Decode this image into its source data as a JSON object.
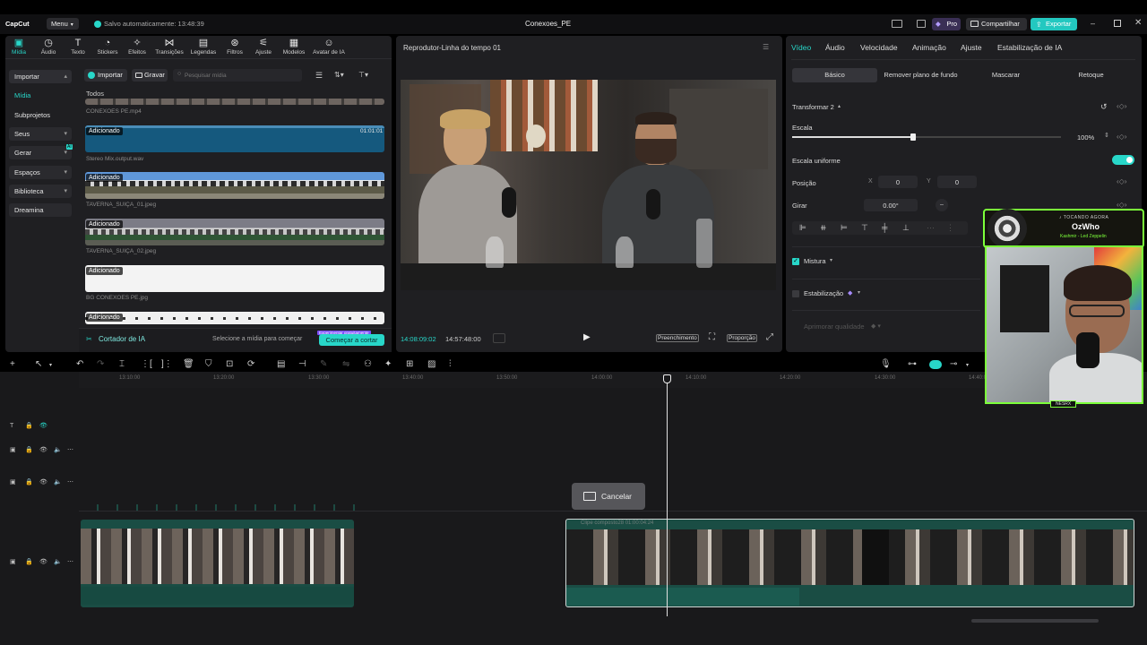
{
  "app": {
    "logo": "CapCut",
    "menu_label": "Menu",
    "autosave": "Salvo automaticamente: 13:48:39",
    "project_title": "Conexoes_PE",
    "pro_label": "Pro",
    "share_label": "Compartilhar",
    "export_label": "Exportar"
  },
  "top_tabs": [
    "Mídia",
    "Áudio",
    "Texto",
    "Stickers",
    "Efeitos",
    "Transições",
    "Legendas",
    "Filtros",
    "Ajuste",
    "Modelos",
    "Avatar de IA"
  ],
  "sidebar": {
    "items": [
      "Importar",
      "Mídia",
      "Subprojetos",
      "Seus",
      "Gerar",
      "Espaços",
      "Biblioteca",
      "Dreamina"
    ],
    "gerar_badge": "AI"
  },
  "media": {
    "import_label": "Importar",
    "record_label": "Gravar",
    "search_placeholder": "Pesquisar mídia",
    "all_label": "Todos",
    "added_tag": "Adicionado",
    "items": [
      "CONEXOES PE.mp4",
      "Stereo Mix.output.wav",
      "TAVERNA_SUIÇA_01.jpeg",
      "TAVERNA_SUIÇA_02.jpeg",
      "BG CONEXOES PE.jpg"
    ],
    "audio_duration": "01:01:01",
    "ai_cutter_label": "Cortador de IA",
    "ai_hint": "Selecione a mídia para começar",
    "start_cut_label": "Começar a cortar",
    "free_trial_tag": "Experimentar gratuitamente"
  },
  "player": {
    "title": "Reprodutor-Linha do tempo 01",
    "current_time": "14:08:09:02",
    "total_time": "14:57:48:00",
    "fill_label": "Preenchimento",
    "ratio_label": "Proporção"
  },
  "properties": {
    "tabs": [
      "Vídeo",
      "Áudio",
      "Velocidade",
      "Animação",
      "Ajuste",
      "Estabilização de IA"
    ],
    "subtabs": [
      "Básico",
      "Remover plano de fundo",
      "Mascarar",
      "Retoque"
    ],
    "transform_label": "Transformar 2",
    "scale_label": "Escala",
    "scale_value": "100%",
    "scale_level": 0.45,
    "uniform_scale_label": "Escala uniforme",
    "position_label": "Posição",
    "pos_x_label": "X",
    "pos_x": "0",
    "pos_y_label": "Y",
    "pos_y": "0",
    "rotate_label": "Girar",
    "rotate_value": "0.00°",
    "blend_label": "Mistura",
    "stabilize_label": "Estabilização",
    "enhance_label": "Aprimorar qualidade"
  },
  "timeline": {
    "ruler": [
      "13:10:00",
      "13:20:00",
      "13:30:00",
      "13:40:00",
      "13:50:00",
      "14:00:00",
      "14:10:00",
      "14:20:00",
      "14:30:00",
      "14:40:00"
    ],
    "compound_clip": "Clipe composto28  01:00:04:24",
    "cancel_label": "Cancelar"
  },
  "webcam": {
    "now_playing_label": "♪ TOCANDO AGORA",
    "song_artist": "OzWho",
    "song_title": "Kashmir - Led Zeppelin",
    "cam_tag": "NESRX"
  },
  "colors": {
    "accent": "#28d7c9",
    "clip_teal": "#1a4d44",
    "panel": "#1f1f22",
    "neon_green": "#7cff3a"
  }
}
